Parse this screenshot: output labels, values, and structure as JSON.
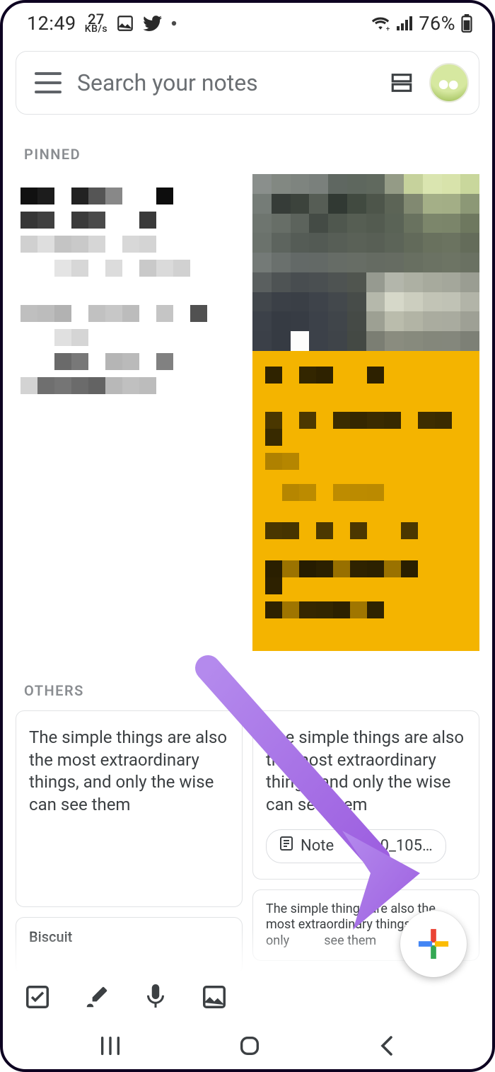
{
  "status": {
    "time": "12:49",
    "net_speed_value": "27",
    "net_speed_unit": "KB/s",
    "battery_pct": "76%"
  },
  "search": {
    "placeholder": "Search your notes"
  },
  "sections": {
    "pinned_label": "PINNED",
    "others_label": "OTHERS"
  },
  "notes": {
    "others": [
      {
        "text": "The simple things are also the most extraordinary things, and only the wise can see them"
      },
      {
        "text": "The simple things are also the most extraordinary things, and only the wise can see them",
        "attachment": "Note",
        "attachment_suffix": "0_105…"
      },
      {
        "title": "Biscuit"
      },
      {
        "text": "The simple things are also the most extraordinary things, and only",
        "text_suffix": "see them"
      }
    ]
  },
  "colors": {
    "accent_arrow": "#a96ee8",
    "yellow_note": "#f4b400"
  }
}
